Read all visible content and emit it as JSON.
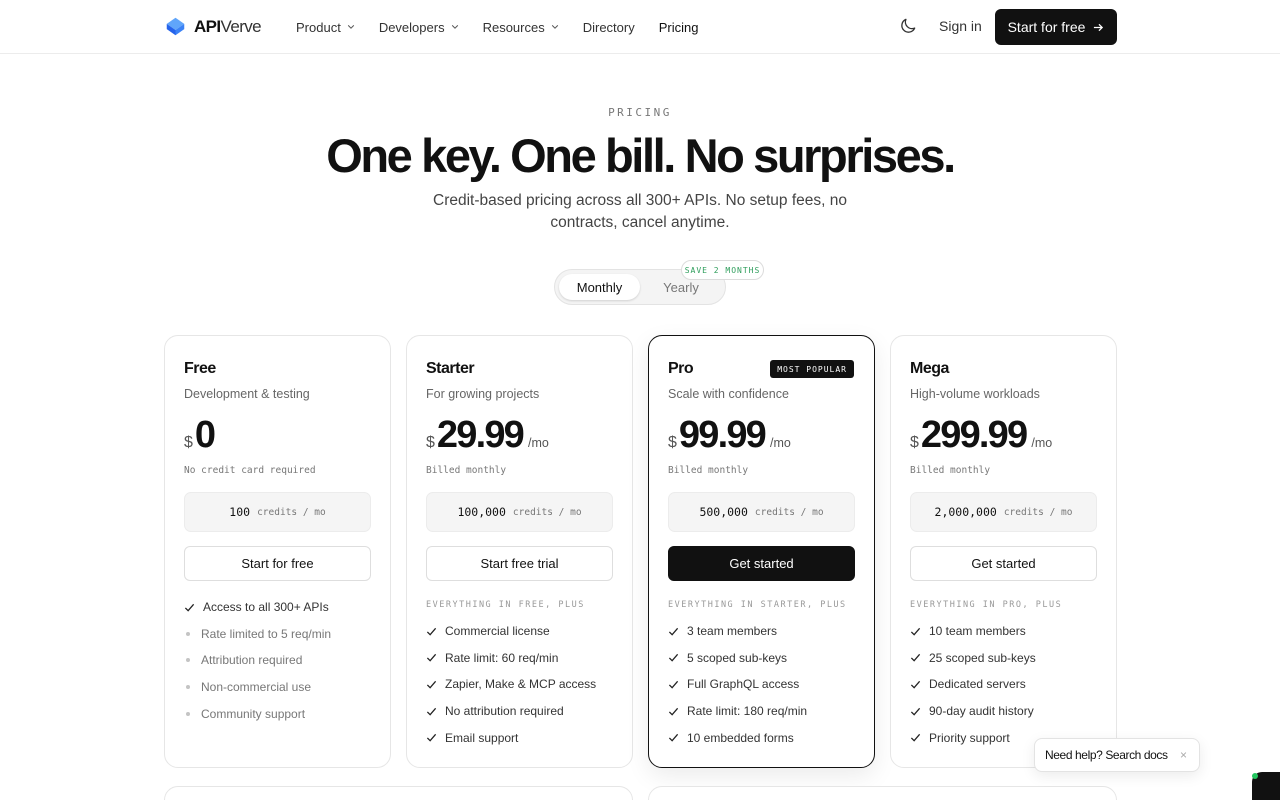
{
  "brand": {
    "name_bold": "API",
    "name_light": "Verve",
    "accent": "#3b82f6"
  },
  "nav": {
    "items": [
      {
        "label": "Product",
        "has_dropdown": true
      },
      {
        "label": "Developers",
        "has_dropdown": true
      },
      {
        "label": "Resources",
        "has_dropdown": true
      },
      {
        "label": "Directory",
        "has_dropdown": false
      },
      {
        "label": "Pricing",
        "has_dropdown": false
      }
    ],
    "theme_icon": "moon-icon",
    "signin_label": "Sign in",
    "cta_label": "Start for free"
  },
  "hero": {
    "eyebrow": "PRICING",
    "title": "One key. One bill. No surprises.",
    "subtitle": "Credit-based pricing across all 300+ APIs. No setup fees, no contracts, cancel anytime."
  },
  "billing_toggle": {
    "monthly_label": "Monthly",
    "yearly_label": "Yearly",
    "selected": "Monthly",
    "save_badge": "SAVE 2 MONTHS"
  },
  "plans": [
    {
      "name": "Free",
      "description": "Development & testing",
      "currency": "$",
      "price": "0",
      "per": "",
      "billing_note": "No credit card required",
      "credits_amount": "100",
      "credits_unit": "credits / mo",
      "button_label": "Start for free",
      "plus_label": "",
      "features": [
        {
          "text": "Access to all 300+ APIs",
          "kind": "check"
        },
        {
          "text": "Rate limited to 5 req/min",
          "kind": "dot"
        },
        {
          "text": "Attribution required",
          "kind": "dot"
        },
        {
          "text": "Non-commercial use",
          "kind": "dot"
        },
        {
          "text": "Community support",
          "kind": "dot"
        }
      ]
    },
    {
      "name": "Starter",
      "description": "For growing projects",
      "currency": "$",
      "price": "29.99",
      "per": "/mo",
      "billing_note": "Billed monthly",
      "credits_amount": "100,000",
      "credits_unit": "credits / mo",
      "button_label": "Start free trial",
      "plus_label": "EVERYTHING IN FREE, PLUS",
      "features": [
        {
          "text": "Commercial license",
          "kind": "check"
        },
        {
          "text": "Rate limit: 60 req/min",
          "kind": "check"
        },
        {
          "text": "Zapier, Make & MCP access",
          "kind": "check"
        },
        {
          "text": "No attribution required",
          "kind": "check"
        },
        {
          "text": "Email support",
          "kind": "check"
        }
      ]
    },
    {
      "name": "Pro",
      "badge": "MOST POPULAR",
      "description": "Scale with confidence",
      "currency": "$",
      "price": "99.99",
      "per": "/mo",
      "billing_note": "Billed monthly",
      "credits_amount": "500,000",
      "credits_unit": "credits / mo",
      "button_label": "Get started",
      "plus_label": "EVERYTHING IN STARTER, PLUS",
      "features": [
        {
          "text": "3 team members",
          "kind": "check"
        },
        {
          "text": "5 scoped sub-keys",
          "kind": "check"
        },
        {
          "text": "Full GraphQL access",
          "kind": "check"
        },
        {
          "text": "Rate limit: 180 req/min",
          "kind": "check"
        },
        {
          "text": "10 embedded forms",
          "kind": "check"
        }
      ]
    },
    {
      "name": "Mega",
      "description": "High-volume workloads",
      "currency": "$",
      "price": "299.99",
      "per": "/mo",
      "billing_note": "Billed monthly",
      "credits_amount": "2,000,000",
      "credits_unit": "credits / mo",
      "button_label": "Get started",
      "plus_label": "EVERYTHING IN PRO, PLUS",
      "features": [
        {
          "text": "10 team members",
          "kind": "check"
        },
        {
          "text": "25 scoped sub-keys",
          "kind": "check"
        },
        {
          "text": "Dedicated servers",
          "kind": "check"
        },
        {
          "text": "90-day audit history",
          "kind": "check"
        },
        {
          "text": "Priority support",
          "kind": "check"
        }
      ]
    }
  ],
  "help_widget": {
    "label": "Need help? Search docs",
    "close": "×"
  },
  "colors": {
    "primary": "#111111",
    "muted": "#777777",
    "save_green": "#2f9e5c"
  }
}
